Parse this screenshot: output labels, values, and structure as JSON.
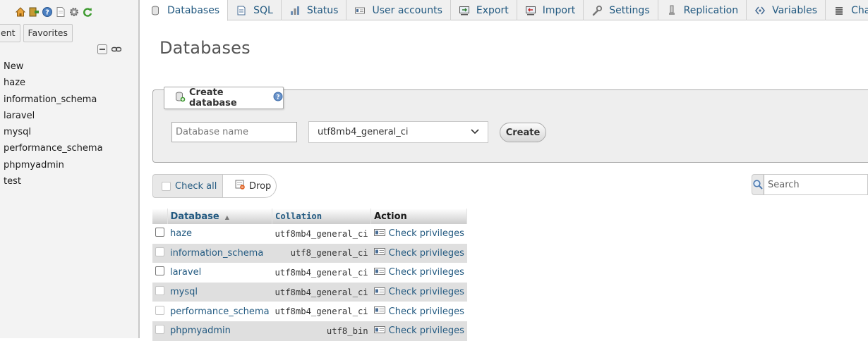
{
  "sidebar": {
    "icons": [
      "home-icon",
      "exit-icon",
      "help-icon",
      "docs-icon",
      "settings-icon",
      "reload-icon"
    ],
    "tabs": [
      "ent",
      "Favorites"
    ],
    "controls": [
      "collapse-all-icon",
      "link-icon"
    ],
    "databases": [
      "New",
      "haze",
      "information_schema",
      "laravel",
      "mysql",
      "performance_schema",
      "phpmyadmin",
      "test"
    ]
  },
  "tabs": [
    {
      "label": "Databases",
      "icon": "database-icon"
    },
    {
      "label": "SQL",
      "icon": "sql-icon"
    },
    {
      "label": "Status",
      "icon": "status-icon"
    },
    {
      "label": "User accounts",
      "icon": "user-accounts-icon"
    },
    {
      "label": "Export",
      "icon": "export-icon"
    },
    {
      "label": "Import",
      "icon": "import-icon"
    },
    {
      "label": "Settings",
      "icon": "wrench-icon"
    },
    {
      "label": "Replication",
      "icon": "replication-icon"
    },
    {
      "label": "Variables",
      "icon": "variables-icon"
    },
    {
      "label": "Charsets",
      "icon": "charsets-icon"
    }
  ],
  "page": {
    "title": "Databases"
  },
  "create": {
    "legend": "Create database",
    "name_placeholder": "Database name",
    "collation": "utf8mb4_general_ci",
    "button": "Create"
  },
  "bulk": {
    "check_all": "Check all",
    "drop": "Drop"
  },
  "search": {
    "placeholder": "Search"
  },
  "table": {
    "headers": {
      "database": "Database",
      "collation": "Collation",
      "action": "Action"
    },
    "rows": [
      {
        "name": "haze",
        "collation": "utf8mb4_general_ci",
        "action": "Check privileges"
      },
      {
        "name": "information_schema",
        "collation": "utf8_general_ci",
        "action": "Check privileges"
      },
      {
        "name": "laravel",
        "collation": "utf8mb4_general_ci",
        "action": "Check privileges"
      },
      {
        "name": "mysql",
        "collation": "utf8mb4_general_ci",
        "action": "Check privileges"
      },
      {
        "name": "performance_schema",
        "collation": "utf8mb4_general_ci",
        "action": "Check privileges"
      },
      {
        "name": "phpmyadmin",
        "collation": "utf8_bin",
        "action": "Check privileges"
      }
    ]
  },
  "colors": {
    "link": "#235a81",
    "sidebar_bg": "#f3f3f3",
    "panel_bg": "#eeeeee",
    "row_alt": "#dfdfdf"
  }
}
